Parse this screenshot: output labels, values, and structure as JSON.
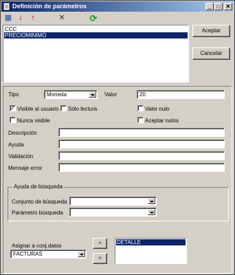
{
  "window": {
    "title": "Definición de parámetros"
  },
  "titlebar_buttons": {
    "minimize": "_",
    "maximize": "□",
    "close": "✕"
  },
  "toolbar": {
    "tools": [
      {
        "name": "add-parameter",
        "icon": "table-add-icon",
        "glyph": "▦"
      },
      {
        "name": "move-down",
        "icon": "arrow-down-icon",
        "glyph": "↓"
      },
      {
        "name": "move-up",
        "icon": "arrow-up-icon",
        "glyph": "↑"
      },
      {
        "name": "delete",
        "icon": "cross-icon",
        "glyph": "✕"
      },
      {
        "name": "refresh",
        "icon": "refresh-icon",
        "glyph": "⟳"
      }
    ]
  },
  "parameters": {
    "items": [
      "CCC",
      "PRECIOMINIMO"
    ],
    "selected": "PRECIOMINIMO"
  },
  "buttons": {
    "accept": "Aceptar",
    "cancel": "Cancelar",
    "add": ">",
    "remove": "<"
  },
  "form": {
    "tipo_label": "Tipo",
    "tipo_value": "Moneda",
    "valor_label": "Valor",
    "valor_value": "20",
    "visible_label": "Visible al usuario",
    "visible_checked": true,
    "solo_lectura_label": "Sólo lectura",
    "solo_lectura_checked": false,
    "valor_nulo_label": "Valor nulo",
    "valor_nulo_checked": false,
    "nunca_visible_label": "Nunca visible",
    "nunca_visible_checked": false,
    "aceptar_nulos_label": "Aceptar nulos",
    "aceptar_nulos_checked": false,
    "descripcion_label": "Descripción",
    "descripcion_value": "",
    "ayuda_label": "Ayuda",
    "ayuda_value": "",
    "validacion_label": "Validación",
    "validacion_value": "",
    "mensaje_error_label": "Mensaje error",
    "mensaje_error_value": ""
  },
  "busqueda": {
    "group_title": "Ayuda de búsqueda",
    "conjunto_label": "Conjunto de búsqueda",
    "conjunto_value": "",
    "parametro_label": "Parámetro búsqueda",
    "parametro_value": ""
  },
  "asignar": {
    "label": "Asignar a conj.datos",
    "value": "FACTURAS",
    "assigned_items": [
      "DETALLE"
    ]
  },
  "colors": {
    "selection": "#0a246a",
    "face": "#d4d0c8",
    "title_start": "#0a246a",
    "title_end": "#a6caf0",
    "refresh": "#1a9a2a",
    "arrows": "#cc0000"
  }
}
